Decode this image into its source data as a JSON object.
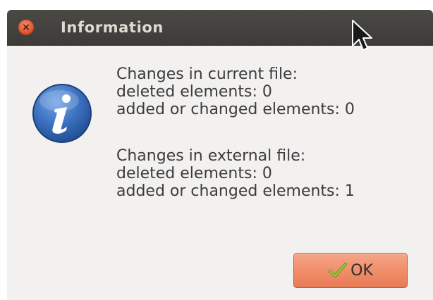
{
  "window": {
    "title": "Information",
    "close_glyph": "×"
  },
  "icon": "info-icon",
  "message": {
    "current": {
      "heading": "Changes in current file:",
      "deleted": "deleted elements: 0",
      "added": "added or changed elements: 0"
    },
    "external": {
      "heading": "Changes in external file:",
      "deleted": "deleted elements: 0",
      "added": "added or changed elements: 1"
    }
  },
  "ok_button": {
    "label": "OK",
    "icon": "checkmark-icon"
  },
  "colors": {
    "titlebar": "#3c3b37",
    "dialog_bg": "#f2f1f0",
    "close_button": "#e1542b",
    "ok_button": "#ef8c68",
    "info_icon": "#2c5ea8",
    "checkmark": "#7fbf2a"
  }
}
